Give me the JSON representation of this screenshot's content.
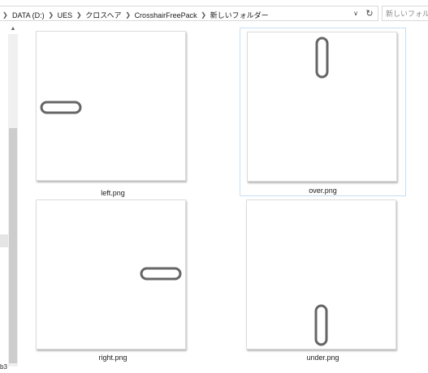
{
  "address_bar": {
    "breadcrumbs": [
      "DATA (D:)",
      "UES",
      "クロスヘア",
      "CrosshairFreePack",
      "新しいフォルダー"
    ],
    "search_placeholder": "新しいフォル"
  },
  "icons": {
    "chevron_separator": "chevron-right-icon",
    "dropdown": "chevron-down-icon",
    "refresh": "refresh-icon",
    "scroll_up": "triangle-up-icon"
  },
  "nav_pane": {
    "clipped_label": "b3"
  },
  "files": [
    {
      "name": "left.png",
      "selected": false
    },
    {
      "name": "over.png",
      "selected": true
    },
    {
      "name": "right.png",
      "selected": false
    },
    {
      "name": "under.png",
      "selected": false
    }
  ],
  "colors": {
    "selection_border": "#c7e0f4",
    "crosshair_stroke": "#666666",
    "scrollbar_thumb": "#cdcdcd"
  }
}
